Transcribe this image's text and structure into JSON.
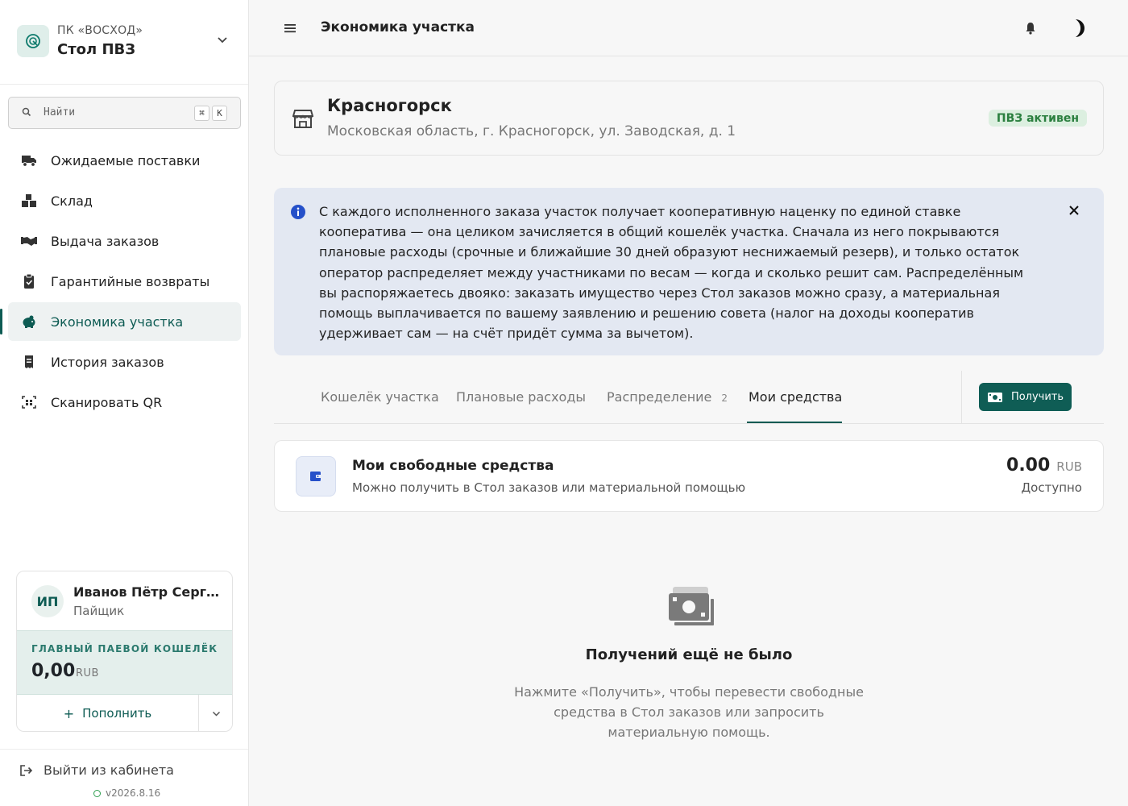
{
  "org": {
    "subtitle": "ПК «ВОСХОД»",
    "name": "Стол ПВЗ"
  },
  "search": {
    "placeholder": "Найти",
    "shortcut_mod": "⌘",
    "shortcut_key": "K"
  },
  "sidebar": {
    "items": [
      {
        "label": "Ожидаемые поставки",
        "icon": "truck-icon"
      },
      {
        "label": "Склад",
        "icon": "boxes-icon"
      },
      {
        "label": "Выдача заказов",
        "icon": "handshake-icon"
      },
      {
        "label": "Гарантийные возвраты",
        "icon": "clipboard-check-icon"
      },
      {
        "label": "Экономика участка",
        "icon": "piggy-bank-icon",
        "active": true
      },
      {
        "label": "История заказов",
        "icon": "receipt-icon"
      },
      {
        "label": "Сканировать QR",
        "icon": "qr-icon"
      }
    ]
  },
  "user": {
    "initials": "ИП",
    "name": "Иванов Пётр Сергеевич",
    "role": "Пайщик",
    "wallet_label": "ГЛАВНЫЙ ПАЕВОЙ КОШЕЛЁК",
    "wallet_amount": "0,00",
    "wallet_currency": "RUB",
    "topup_label": "Пополнить"
  },
  "footer": {
    "logout_label": "Выйти из кабинета",
    "version": "v2026.8.16"
  },
  "header": {
    "title": "Экономика участка"
  },
  "location": {
    "city": "Красногорск",
    "address": "Московская область, г. Красногорск, ул. Заводская, д. 1",
    "status": "ПВЗ активен"
  },
  "info_banner": {
    "text": "С каждого исполненного заказа участок получает кооперативную наценку по единой ставке кооператива — она целиком зачисляется в общий кошелёк участка. Сначала из него покрываются плановые расходы (срочные и ближайшие 30 дней образуют неснижаемый резерв), и только остаток оператор распределяет между участниками по весам — когда и сколько решит сам. Распределённым вы распоряжаетесь двояко: заказать имущество через Стол заказов можно сразу, а материальная помощь выплачивается по вашему заявлению и решению совета (налог на доходы кооператив удерживает сам — на счёт придёт сумма за вычетом)."
  },
  "tabs": {
    "items": [
      {
        "label": "Кошелёк участка"
      },
      {
        "label": "Плановые расходы"
      },
      {
        "label": "Распределение",
        "count": "2"
      },
      {
        "label": "Мои средства",
        "active": true
      }
    ],
    "action_label": "Получить"
  },
  "funds": {
    "title": "Мои свободные средства",
    "subtitle": "Можно получить в Стол заказов или материальной помощью",
    "amount": "0.00",
    "currency": "RUB",
    "status": "Доступно"
  },
  "empty": {
    "title": "Получений ещё не было",
    "text": "Нажмите «Получить», чтобы перевести свободные средства в Стол заказов или запросить материальную помощь."
  },
  "colors": {
    "accent": "#0d5b53",
    "badge_bg": "#dcefe0",
    "banner_bg": "#e3e8f2",
    "wallet_bg": "#e4efec"
  }
}
